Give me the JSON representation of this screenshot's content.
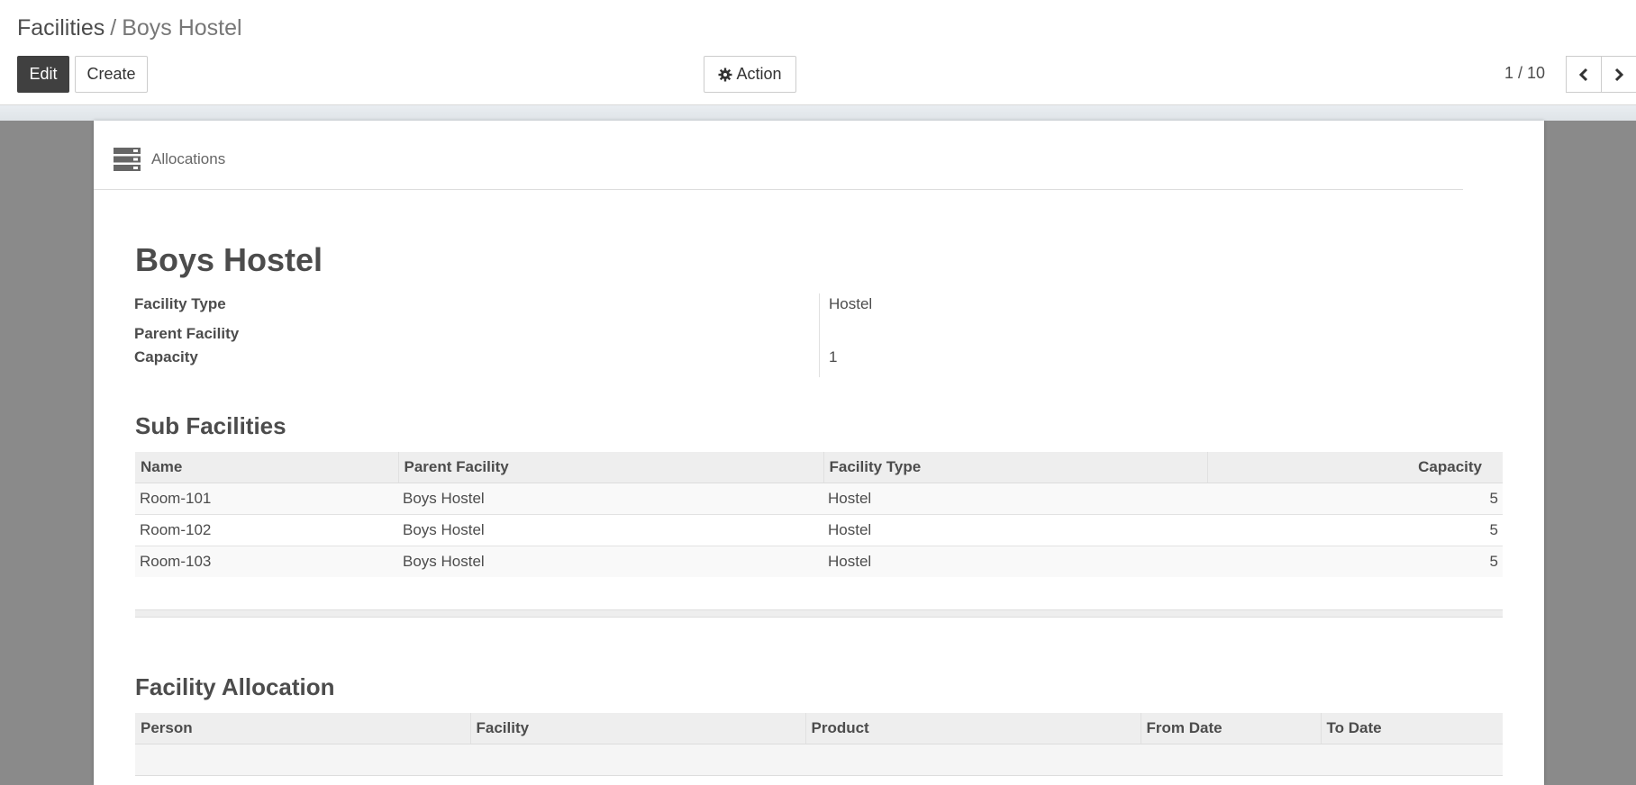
{
  "breadcrumb": {
    "parent": "Facilities",
    "separator": "/",
    "current": "Boys Hostel"
  },
  "toolbar": {
    "edit_label": "Edit",
    "create_label": "Create",
    "action_label": "Action"
  },
  "pager": {
    "value": "1 / 10"
  },
  "smart_button": {
    "label": "Allocations"
  },
  "record": {
    "title": "Boys Hostel",
    "fields": {
      "facility_type_label": "Facility Type",
      "facility_type_value": "Hostel",
      "parent_facility_label": "Parent Facility",
      "parent_facility_value": "",
      "capacity_label": "Capacity",
      "capacity_value": "1"
    }
  },
  "sub_facilities": {
    "title": "Sub Facilities",
    "columns": [
      "Name",
      "Parent Facility",
      "Facility Type",
      "Capacity"
    ],
    "rows": [
      [
        "Room-101",
        "Boys Hostel",
        "Hostel",
        "5"
      ],
      [
        "Room-102",
        "Boys Hostel",
        "Hostel",
        "5"
      ],
      [
        "Room-103",
        "Boys Hostel",
        "Hostel",
        "5"
      ]
    ]
  },
  "facility_allocation": {
    "title": "Facility Allocation",
    "columns": [
      "Person",
      "Facility",
      "Product",
      "From Date",
      "To Date"
    ],
    "rows": []
  },
  "colors": {
    "primary_button": "#404040",
    "form_background": "#8a8a8a"
  }
}
